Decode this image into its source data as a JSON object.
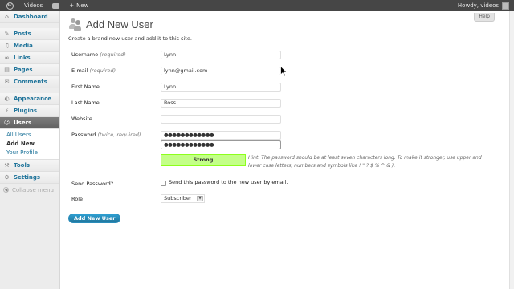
{
  "adminbar": {
    "site_name": "Videos",
    "new_label": "New",
    "howdy": "Howdy, videos"
  },
  "sidebar": {
    "items": [
      {
        "label": "Dashboard",
        "icon": "dashboard-icon"
      },
      {
        "label": "Posts",
        "icon": "posts-icon"
      },
      {
        "label": "Media",
        "icon": "media-icon"
      },
      {
        "label": "Links",
        "icon": "links-icon"
      },
      {
        "label": "Pages",
        "icon": "pages-icon"
      },
      {
        "label": "Comments",
        "icon": "comments-icon"
      },
      {
        "label": "Appearance",
        "icon": "appearance-icon"
      },
      {
        "label": "Plugins",
        "icon": "plugins-icon"
      },
      {
        "label": "Users",
        "icon": "users-icon"
      },
      {
        "label": "Tools",
        "icon": "tools-icon"
      },
      {
        "label": "Settings",
        "icon": "settings-icon"
      }
    ],
    "users_submenu": [
      "All Users",
      "Add New",
      "Your Profile"
    ],
    "collapse": "Collapse menu"
  },
  "main": {
    "help": "Help",
    "title": "Add New User",
    "intro": "Create a brand new user and add it to this site.",
    "fields": {
      "username": {
        "label": "Username",
        "note": "(required)",
        "value": "Lynn"
      },
      "email": {
        "label": "E-mail",
        "note": "(required)",
        "value": "lynn@gmail.com"
      },
      "first_name": {
        "label": "First Name",
        "value": "Lynn"
      },
      "last_name": {
        "label": "Last Name",
        "value": "Ross"
      },
      "website": {
        "label": "Website",
        "value": ""
      },
      "password": {
        "label": "Password",
        "note": "(twice, required)",
        "value1": "●●●●●●●●●●●●",
        "value2": "●●●●●●●●●●●●"
      }
    },
    "strength": "Strong",
    "hint": "Hint: The password should be at least seven characters long. To make it stronger, use upper and lower case letters, numbers and symbols like ! \" ? $ % ^ & ).",
    "send_password": {
      "label": "Send Password?",
      "text": "Send this password to the new user by email."
    },
    "role": {
      "label": "Role",
      "value": "Subscriber"
    },
    "submit": "Add New User"
  },
  "colors": {
    "adminbar": "#464646",
    "link": "#21759b",
    "strength_bg": "#c3ff88",
    "button": "#21759b"
  }
}
